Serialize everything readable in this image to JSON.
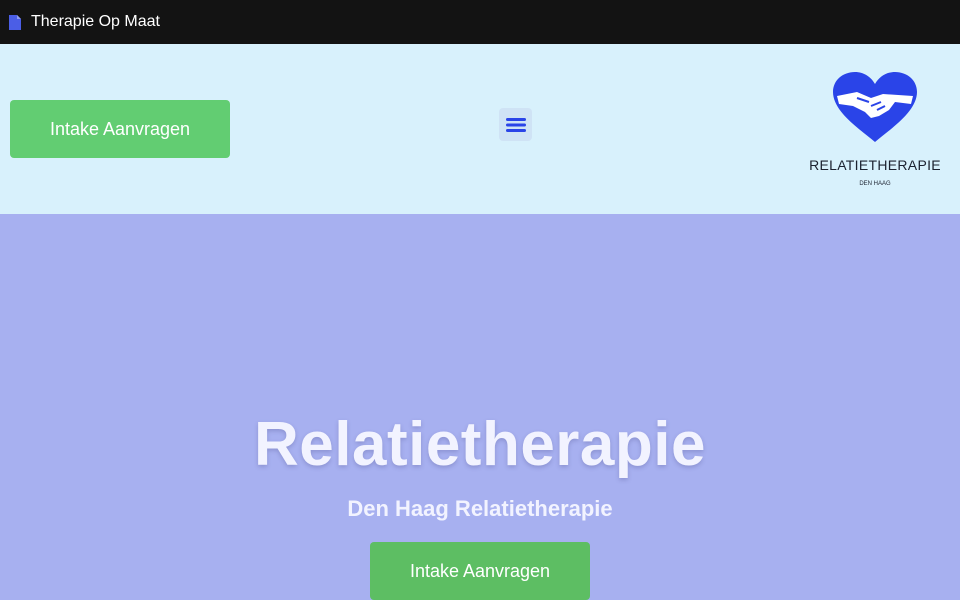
{
  "window": {
    "title": "Therapie Op Maat",
    "icon": "document-icon"
  },
  "header": {
    "intake_label": "Intake Aanvragen",
    "menu_icon": "hamburger-menu-icon",
    "logo": {
      "icon": "heart-handshake-icon",
      "brand": "RELATIETHERAPIE",
      "sub": "DEN HAAG"
    }
  },
  "hero": {
    "title": "Relatietherapie",
    "subtitle": "Den Haag Relatietherapie",
    "cta_label": "Intake Aanvragen"
  },
  "colors": {
    "topbar_bg": "#131313",
    "header_bg": "#d8f1fc",
    "hero_bg": "#a7b0f0",
    "button_green": "#62cd72",
    "logo_blue": "#2a44e8"
  }
}
